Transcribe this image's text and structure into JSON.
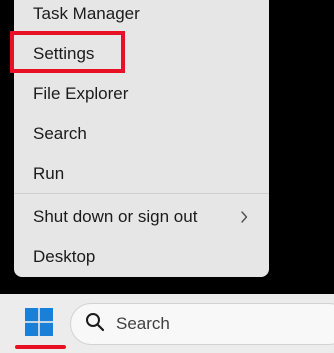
{
  "menu": {
    "items": [
      {
        "label": "Task Manager"
      },
      {
        "label": "Settings"
      },
      {
        "label": "File Explorer"
      },
      {
        "label": "Search"
      },
      {
        "label": "Run"
      },
      {
        "label": "Shut down or sign out"
      },
      {
        "label": "Desktop"
      }
    ]
  },
  "taskbar": {
    "search_placeholder": "Search"
  },
  "colors": {
    "highlight": "#e81123",
    "start_icon": "#1a7fd6",
    "menu_background": "#e6e6e6",
    "taskbar_background": "#ececec"
  },
  "icons": {
    "start": "windows-logo-icon",
    "search": "search-icon",
    "submenu": "chevron-right-icon"
  }
}
